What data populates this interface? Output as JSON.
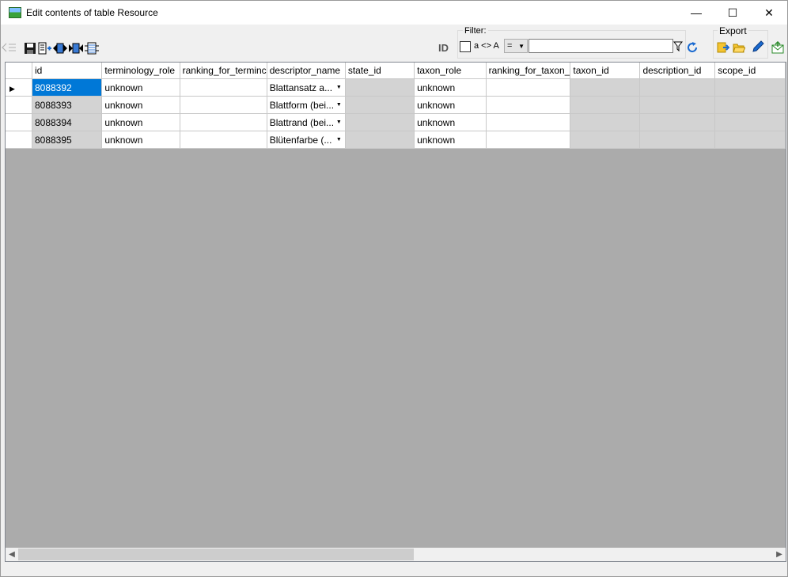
{
  "window": {
    "title": "Edit contents of table Resource",
    "minimize": "—",
    "maximize": "☐",
    "close": "✕"
  },
  "toolbar": {
    "id_label": "ID",
    "filter_label": "Filter:",
    "case_label": "a <> A",
    "operator": "=",
    "filter_value": "",
    "export_label": "Export"
  },
  "grid": {
    "columns": [
      "id",
      "terminology_role",
      "ranking_for_terminc",
      "descriptor_name",
      "state_id",
      "taxon_role",
      "ranking_for_taxon_",
      "taxon_id",
      "description_id",
      "scope_id"
    ],
    "rows": [
      {
        "id": "8088392",
        "terminology_role": "unknown",
        "ranking": "",
        "descriptor_name": "Blattansatz a...",
        "state_id": "",
        "taxon_role": "unknown",
        "ranking_taxon": ""
      },
      {
        "id": "8088393",
        "terminology_role": "unknown",
        "ranking": "",
        "descriptor_name": "Blattform (bei...",
        "state_id": "",
        "taxon_role": "unknown",
        "ranking_taxon": ""
      },
      {
        "id": "8088394",
        "terminology_role": "unknown",
        "ranking": "",
        "descriptor_name": "Blattrand (bei...",
        "state_id": "",
        "taxon_role": "unknown",
        "ranking_taxon": ""
      },
      {
        "id": "8088395",
        "terminology_role": "unknown",
        "ranking": "",
        "descriptor_name": "Blütenfarbe (...",
        "state_id": "",
        "taxon_role": "unknown",
        "ranking_taxon": ""
      }
    ]
  },
  "colors": {
    "selection": "#0078d7",
    "grid_bg": "#ababab",
    "readonly": "#d3d3d3"
  }
}
